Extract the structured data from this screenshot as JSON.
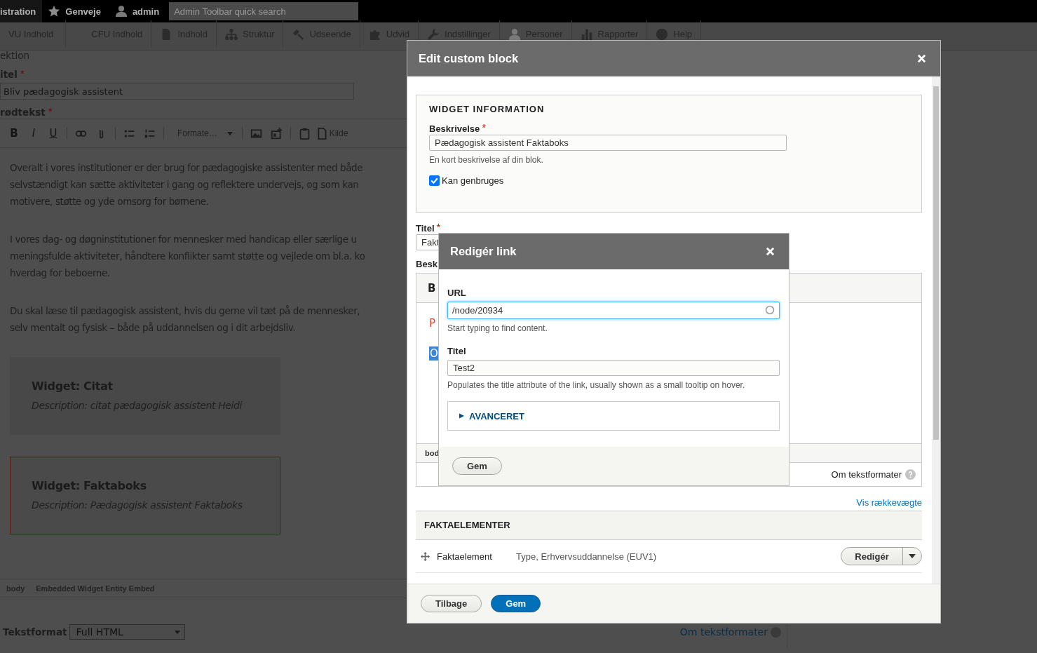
{
  "admin_toolbar": {
    "items": [
      {
        "label": "istration"
      },
      {
        "label": "Genveje"
      },
      {
        "label": "admin"
      }
    ],
    "search": {
      "placeholder": "Admin Toolbar quick search"
    }
  },
  "menu": [
    {
      "label": "VU Indhold"
    },
    {
      "label": "CFU Indhold"
    },
    {
      "label": "Indhold"
    },
    {
      "label": "Struktur"
    },
    {
      "label": "Udseende"
    },
    {
      "label": "Udvid"
    },
    {
      "label": "Indstillinger"
    },
    {
      "label": "Personer"
    },
    {
      "label": "Rapporter"
    },
    {
      "label": "Help"
    }
  ],
  "form": {
    "section_label": "ektion",
    "title": {
      "label": "itel",
      "required_mark": "*",
      "value": "Bliv pædagogisk assistent"
    },
    "body": {
      "label": "rødtekst",
      "required_mark": "*",
      "toolbar": {
        "bold": "B",
        "italic": "I",
        "underline": "U",
        "format": "Formate…",
        "source": "Kilde"
      },
      "paragraphs": [
        [
          "Overalt i vores institutioner er der brug for pædagogiske assistenter med både",
          "selvstændigt kan sætte aktiviteter i gang og reflektere undervejs, og som kan",
          "motivere, støtte og yde omsorg for børnene."
        ],
        [
          "I vores dag- og døgninstitutioner for mennesker med handicap eller særlige u",
          "meningsfulde aktiviteter, håndtere konflikter samt støtte og vejlede om bl.a. ko",
          "hverdag for beboerne."
        ],
        [
          "Du skal læse til pædagogisk assistent, hvis du gerne vil tæt på de mennesker,",
          "selv mentalt og fysisk – både på uddannelsen og i dit arbejdsliv."
        ]
      ],
      "widgets": [
        {
          "title": "Widget: Citat",
          "description": "Description: citat pædagogisk assistent Heidi",
          "selected": false
        },
        {
          "title": "Widget: Faktaboks",
          "description": "Description: Pædagogisk assistent Faktaboks",
          "selected": true
        }
      ],
      "path": [
        "body",
        "Embedded Widget Entity Embed"
      ]
    },
    "text_format": {
      "label": "Tekstformat",
      "value": "Full HTML"
    },
    "format_help": "Om tekstformater"
  },
  "dialog": {
    "title": "Edit custom block",
    "widget_info": {
      "legend": "WIDGET INFORMATION",
      "description": {
        "label": "Beskrivelse",
        "required_mark": "*",
        "value": "Pædagogisk assistent Faktaboks",
        "help": "En kort beskrivelse af din blok."
      },
      "reusable": {
        "label": "Kan genbruges",
        "checked": true
      }
    },
    "title_field": {
      "label": "Titel",
      "required_mark": "*",
      "value": "Fakt"
    },
    "body_label": "Besk",
    "editor": {
      "toolbar_letter": "B",
      "text": "P",
      "selection": {
        "text": "O",
        "selected": true
      },
      "path": "bod",
      "format_help": "Om tekstformater"
    },
    "weights_link": "Vis rækkevægte",
    "facts": {
      "heading": "FAKTAELEMENTER",
      "rows": [
        {
          "name": "Faktaelement",
          "summary": "Type, Erhvervsuddannelse (EUV1)",
          "button": "Redigér"
        }
      ]
    },
    "buttons": [
      {
        "label": "Tilbage",
        "primary": false
      },
      {
        "label": "Gem",
        "primary": true
      }
    ]
  },
  "link_dialog": {
    "title": "Redigér link",
    "url": {
      "label": "URL",
      "value": "/node/20934",
      "help": "Start typing to find content.",
      "focused": true
    },
    "title_field": {
      "label": "Titel",
      "value": "Test2",
      "help": "Populates the title attribute of the link, usually shown as a small tooltip on hover."
    },
    "advanced": {
      "label": "AVANCERET",
      "expanded": false
    },
    "button": "Gem"
  }
}
